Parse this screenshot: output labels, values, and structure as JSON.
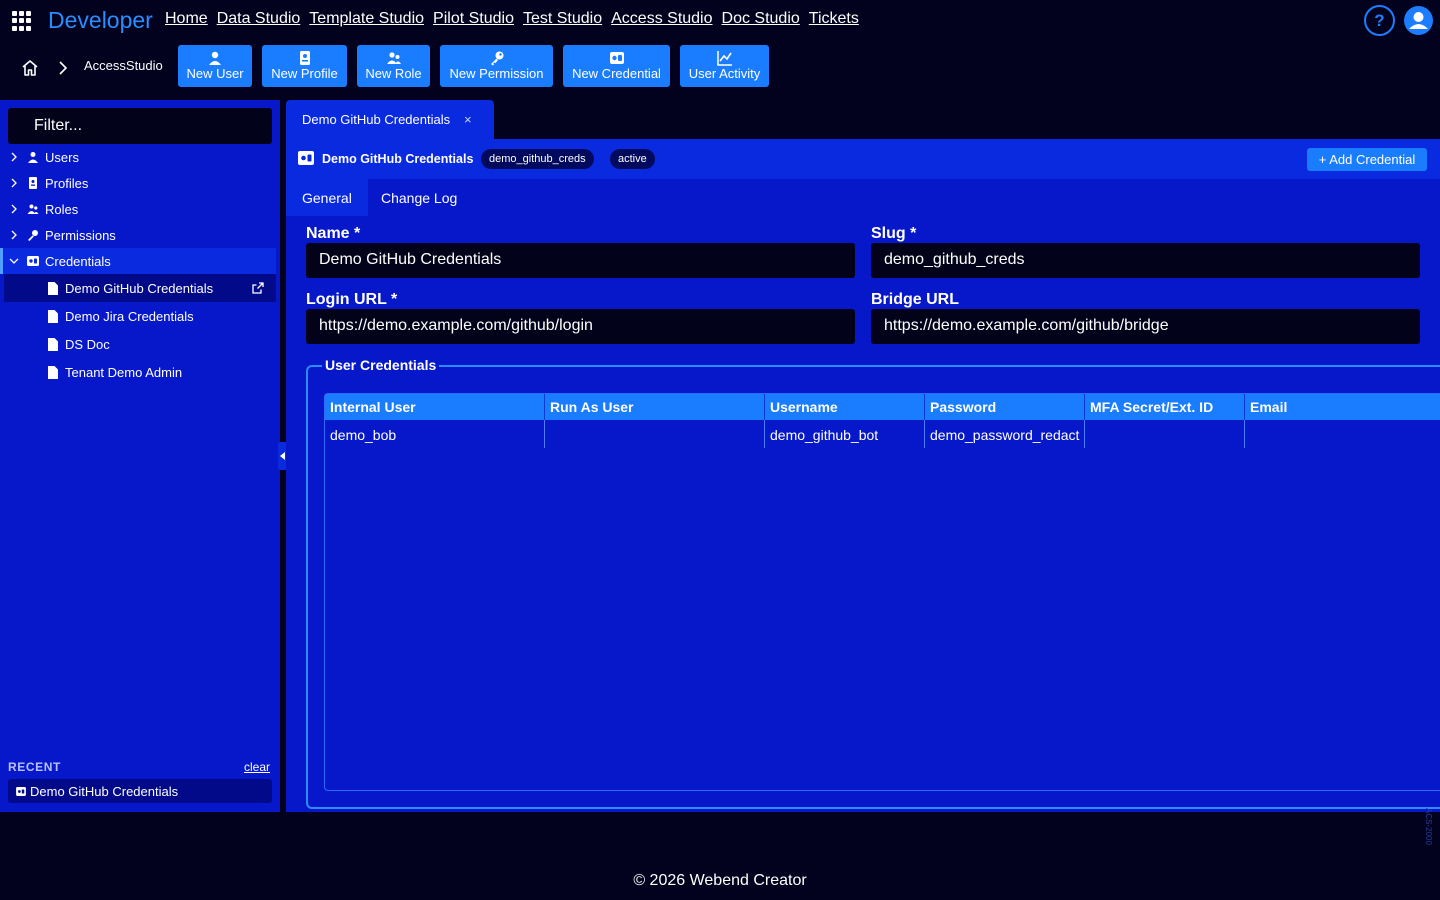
{
  "app": {
    "brand": "Developer",
    "nav": [
      "Home",
      "Data Studio",
      "Template Studio",
      "Pilot Studio",
      "Test Studio",
      "Access Studio",
      "Doc Studio",
      "Tickets"
    ],
    "help_label": "?"
  },
  "breadcrumb": {
    "current": "AccessStudio"
  },
  "toolbar": {
    "new_user": "New User",
    "new_profile": "New Profile",
    "new_role": "New Role",
    "new_permission": "New Permission",
    "new_credential": "New Credential",
    "user_activity": "User Activity"
  },
  "sidebar": {
    "filter_placeholder": "Filter...",
    "items": [
      {
        "label": "Users",
        "icon": "user-icon"
      },
      {
        "label": "Profiles",
        "icon": "profile-icon"
      },
      {
        "label": "Roles",
        "icon": "roles-icon"
      },
      {
        "label": "Permissions",
        "icon": "key-icon"
      },
      {
        "label": "Credentials",
        "icon": "credential-icon"
      }
    ],
    "credentials_children": [
      "Demo GitHub Credentials",
      "Demo Jira Credentials",
      "DS Doc",
      "Tenant Demo Admin"
    ],
    "recent_title": "RECENT",
    "recent_clear": "clear",
    "recent_items": [
      "Demo GitHub Credentials"
    ]
  },
  "main": {
    "tab_label": "Demo GitHub Credentials",
    "tab_close": "×",
    "header": {
      "title": "Demo GitHub Credentials",
      "slug_badge": "demo_github_creds",
      "status_badge": "active",
      "add_button": "+ Add Credential"
    },
    "subtabs": [
      "General",
      "Change Log"
    ],
    "form": {
      "name_label": "Name *",
      "name_value": "Demo GitHub Credentials",
      "slug_label": "Slug *",
      "slug_value": "demo_github_creds",
      "login_url_label": "Login URL *",
      "login_url_value": "https://demo.example.com/github/login",
      "bridge_url_label": "Bridge URL",
      "bridge_url_value": "https://demo.example.com/github/bridge"
    },
    "user_credentials": {
      "legend": "User Credentials",
      "columns": [
        "Internal User",
        "Run As User",
        "Username",
        "Password",
        "MFA Secret/Ext. ID",
        "Email"
      ],
      "rows": [
        [
          "demo_bob",
          "",
          "demo_github_bot",
          "demo_password_redact",
          "",
          ""
        ]
      ]
    }
  },
  "watermark": "ACS-2000",
  "footer": "© 2026 Webend Creator",
  "colors": {
    "accent": "#1a7dff",
    "panel": "#0618c9",
    "background": "#02021f"
  }
}
